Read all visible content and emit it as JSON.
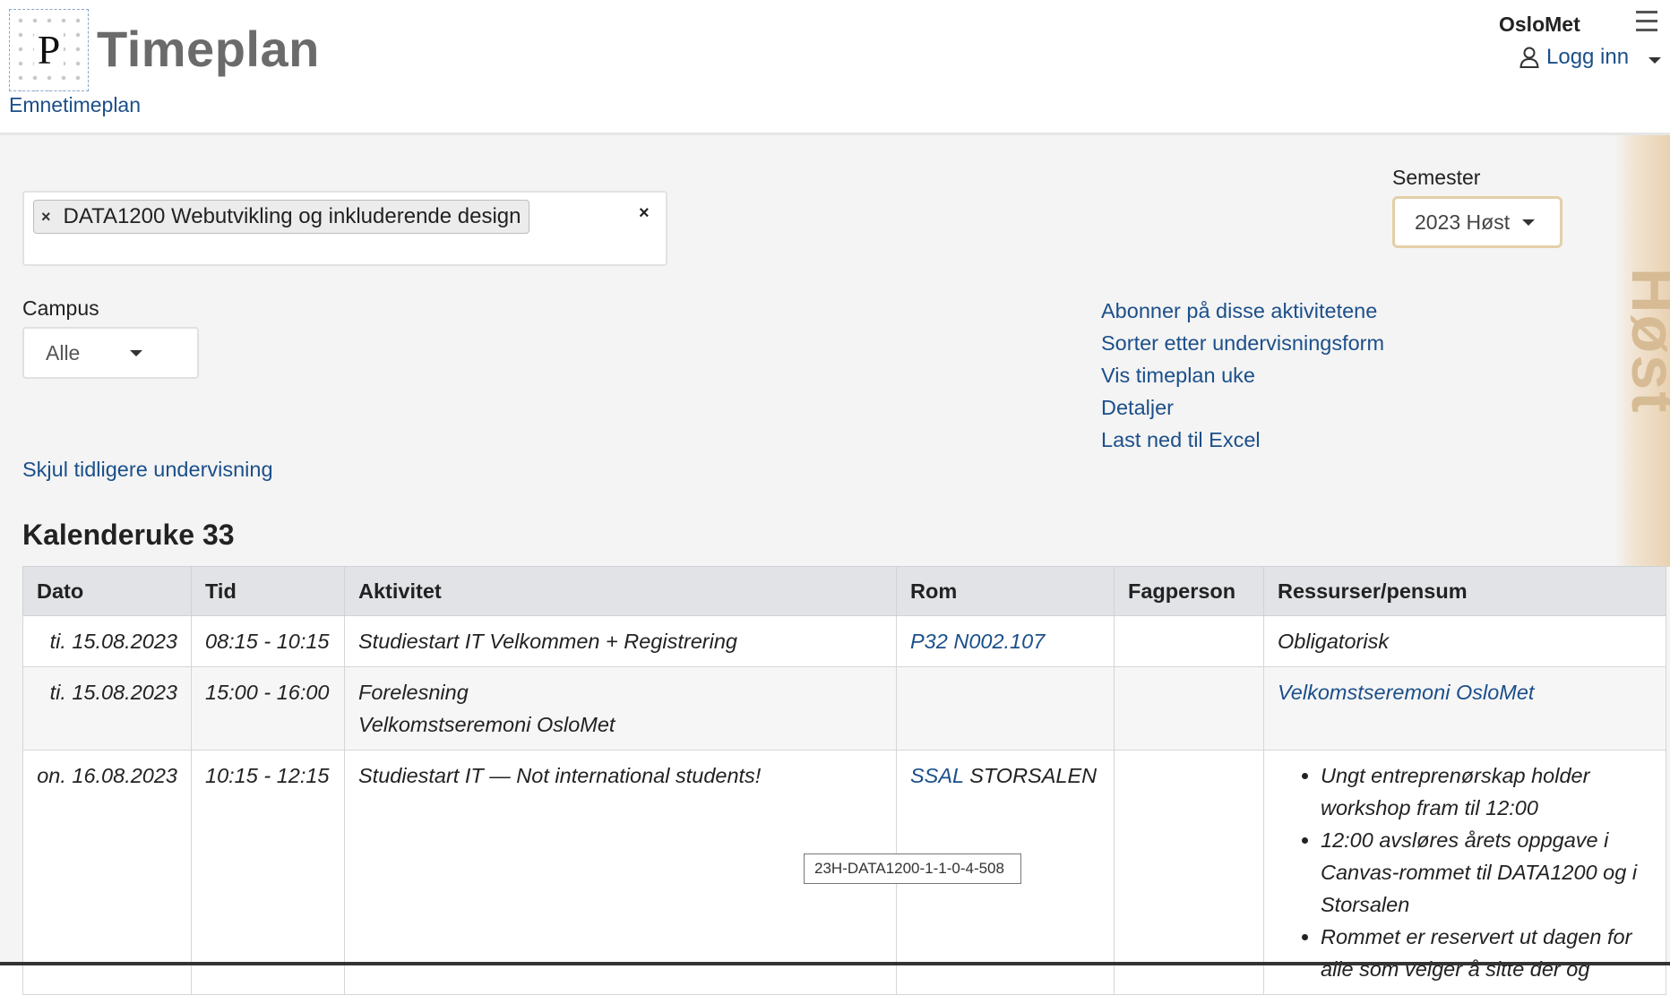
{
  "header": {
    "logo_letter": "P",
    "title": "Timeplan",
    "subnav_link": "Emnetimeplan",
    "org": "OsloMet",
    "login_label": "Logg inn"
  },
  "filters": {
    "selected_course": "DATA1200 Webutvikling og inkluderende design",
    "semester_label": "Semester",
    "semester_value": "2023 Høst",
    "campus_label": "Campus",
    "campus_value": "Alle"
  },
  "season_label": "Høst",
  "actions": [
    "Abonner på disse aktivitetene",
    "Sorter etter undervisningsform",
    "Vis timeplan uke",
    "Detaljer",
    "Last ned til Excel"
  ],
  "hide_link": "Skjul tidligere undervisning",
  "week_title": "Kalenderuke 33",
  "table": {
    "headers": [
      "Dato",
      "Tid",
      "Aktivitet",
      "Rom",
      "Fagperson",
      "Ressurser/pensum"
    ],
    "rows": [
      {
        "date": "ti. 15.08.2023",
        "time": "08:15 - 10:15",
        "activity_line1": "Studiestart IT Velkommen + Registrering",
        "activity_line2": "",
        "room_link": "P32 N002.107",
        "room_text": "",
        "staff": "",
        "resource_text": "Obligatorisk",
        "resource_link": ""
      },
      {
        "date": "ti. 15.08.2023",
        "time": "15:00 - 16:00",
        "activity_line1": "Forelesning",
        "activity_line2": "Velkomstseremoni OsloMet",
        "room_link": "",
        "room_text": "",
        "staff": "",
        "resource_text": "",
        "resource_link": "Velkomstseremoni OsloMet"
      },
      {
        "date": "on. 16.08.2023",
        "time": "10:15 - 12:15",
        "activity_line1": "Studiestart IT — Not international students!",
        "activity_line2": "",
        "room_link": "SSAL",
        "room_text": " STORSALEN",
        "staff": "",
        "resource_bullets": [
          "Ungt entreprenørskap holder workshop fram til 12:00",
          "12:00 avsløres årets oppgave i Canvas-rommet til DATA1200 og i Storsalen",
          "Rommet er reservert ut dagen for alle som velger å sitte der og"
        ]
      }
    ]
  },
  "tooltip": "23H-DATA1200-1-1-0-4-508"
}
